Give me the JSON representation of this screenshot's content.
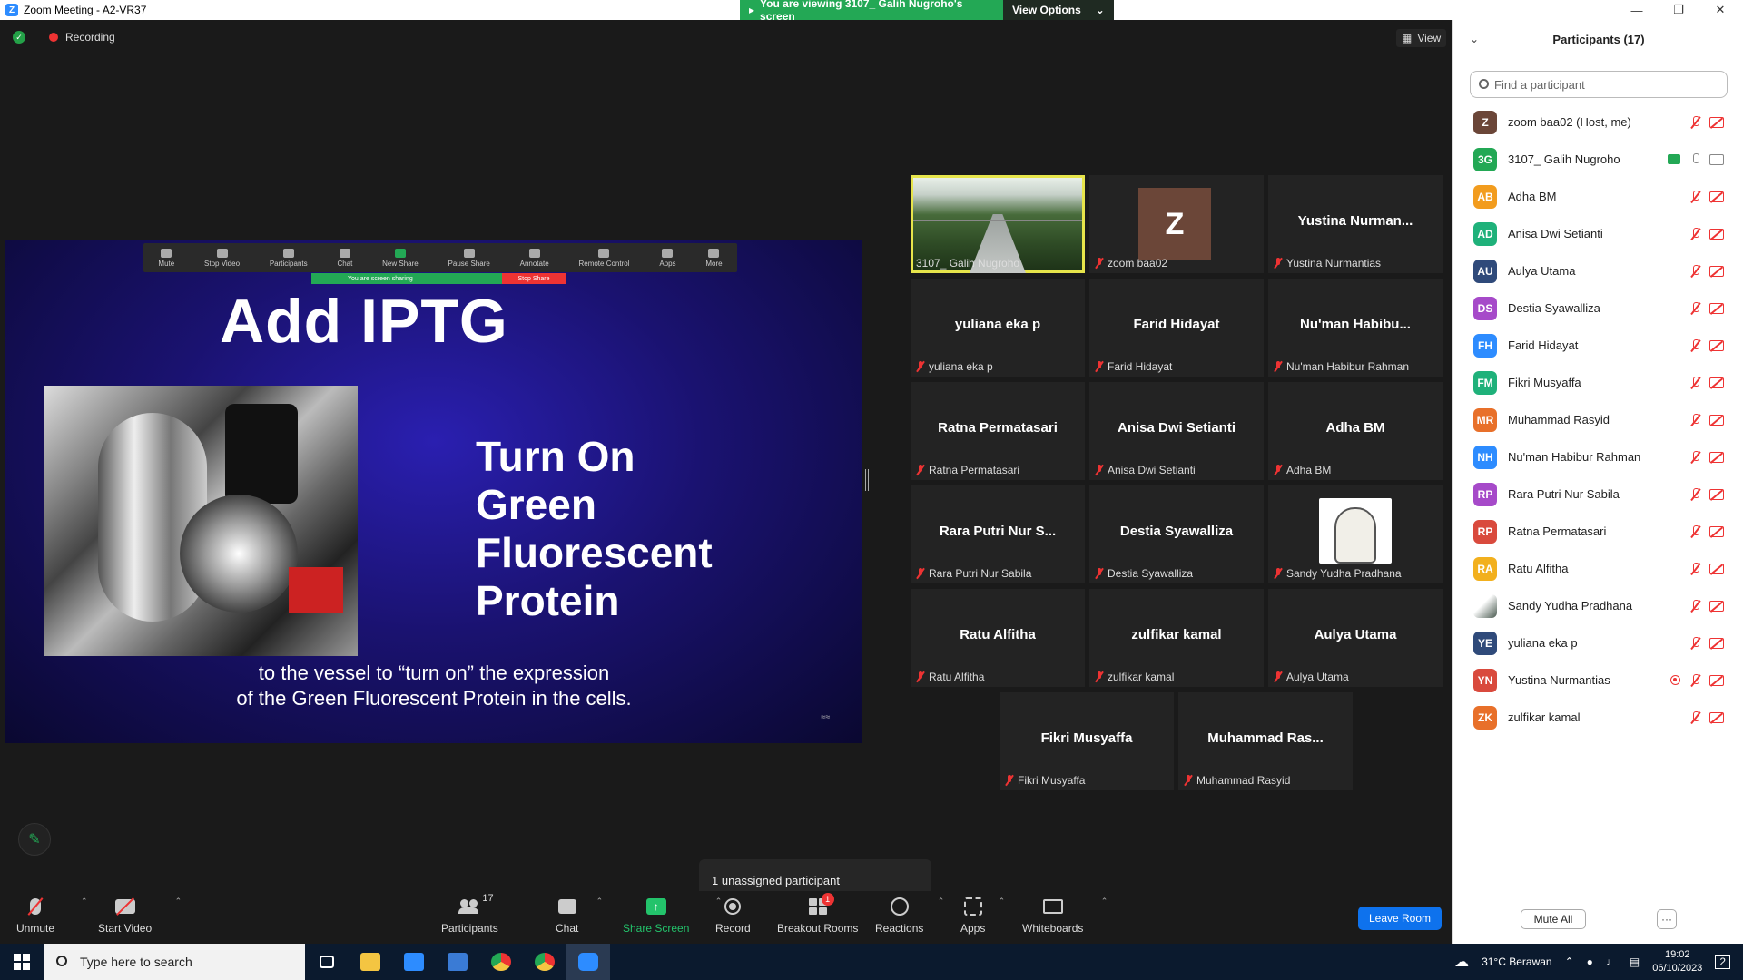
{
  "window": {
    "title": "Zoom Meeting - A2-VR37",
    "logo_letter": "Z"
  },
  "banner": {
    "viewing_text": "You are viewing 3107_ Galih Nugroho's screen",
    "view_options": "View Options"
  },
  "status": {
    "recording": "Recording",
    "view_label": "View"
  },
  "shared_screen": {
    "mini_toolbar": [
      "Mute",
      "Stop Video",
      "Participants",
      "Chat",
      "New Share",
      "Pause Share",
      "Annotate",
      "Remote Control",
      "Apps",
      "More"
    ],
    "mini_share_text": "You are screen sharing",
    "mini_stop": "Stop Share",
    "slide_title": "Add IPTG",
    "slide_lines": [
      "Turn On",
      "Green",
      "Fluorescent",
      "Protein"
    ],
    "caption_1": "to the vessel to “turn on” the expression",
    "caption_2": "of the Green Fluorescent Protein in the cells."
  },
  "grid": [
    {
      "display": "",
      "label": "3107_ Galih Nugroho",
      "muted": false,
      "kind": "video",
      "active": true
    },
    {
      "display": "Z",
      "label": "zoom baa02",
      "muted": true,
      "kind": "avatar"
    },
    {
      "display": "Yustina  Nurman...",
      "label": "Yustina Nurmantias",
      "muted": true,
      "kind": "name"
    },
    {
      "display": "yuliana eka p",
      "label": "yuliana eka p",
      "muted": true,
      "kind": "name"
    },
    {
      "display": "Farid Hidayat",
      "label": "Farid Hidayat",
      "muted": true,
      "kind": "name"
    },
    {
      "display": "Nu'man  Habibu...",
      "label": "Nu'man Habibur Rahman",
      "muted": true,
      "kind": "name"
    },
    {
      "display": "Ratna Permatasari",
      "label": "Ratna Permatasari",
      "muted": true,
      "kind": "name"
    },
    {
      "display": "Anisa Dwi Setianti",
      "label": "Anisa Dwi Setianti",
      "muted": true,
      "kind": "name"
    },
    {
      "display": "Adha BM",
      "label": "Adha BM",
      "muted": true,
      "kind": "name"
    },
    {
      "display": "Rara Putri Nur S...",
      "label": "Rara Putri Nur Sabila",
      "muted": true,
      "kind": "name"
    },
    {
      "display": "Destia Syawalliza",
      "label": "Destia Syawalliza",
      "muted": true,
      "kind": "name"
    },
    {
      "display": "",
      "label": "Sandy Yudha Pradhana",
      "muted": true,
      "kind": "bear"
    },
    {
      "display": "Ratu Alfitha",
      "label": "Ratu Alfitha",
      "muted": true,
      "kind": "name"
    },
    {
      "display": "zulfikar kamal",
      "label": "zulfikar kamal",
      "muted": true,
      "kind": "name"
    },
    {
      "display": "Aulya Utama",
      "label": "Aulya Utama",
      "muted": true,
      "kind": "name"
    },
    {
      "display": "Fikri Musyaffa",
      "label": "Fikri Musyaffa",
      "muted": true,
      "kind": "name"
    },
    {
      "display": "Muhammad  Ras...",
      "label": "Muhammad Rasyid",
      "muted": true,
      "kind": "name"
    }
  ],
  "participants_panel": {
    "title": "Participants (17)",
    "search_placeholder": "Find a participant",
    "mute_all": "Mute All",
    "more": "···",
    "list": [
      {
        "initials": "Z",
        "name": "zoom baa02 (Host, me)",
        "color": "#6b4638",
        "mic": "off",
        "cam": "off"
      },
      {
        "initials": "3G",
        "name": "3107_ Galih Nugroho",
        "color": "#23a855",
        "mic": "on",
        "cam": "on",
        "sharing": true
      },
      {
        "initials": "AB",
        "name": "Adha BM",
        "color": "#f29c1e",
        "mic": "off",
        "cam": "off"
      },
      {
        "initials": "AD",
        "name": "Anisa Dwi Setianti",
        "color": "#1fb17a",
        "mic": "off",
        "cam": "off"
      },
      {
        "initials": "AU",
        "name": "Aulya Utama",
        "color": "#2f4a7a",
        "mic": "off",
        "cam": "off"
      },
      {
        "initials": "DS",
        "name": "Destia Syawalliza",
        "color": "#a64ac9",
        "mic": "off",
        "cam": "off"
      },
      {
        "initials": "FH",
        "name": "Farid Hidayat",
        "color": "#2d8cff",
        "mic": "off",
        "cam": "off"
      },
      {
        "initials": "FM",
        "name": "Fikri Musyaffa",
        "color": "#1fb17a",
        "mic": "off",
        "cam": "off"
      },
      {
        "initials": "MR",
        "name": "Muhammad Rasyid",
        "color": "#e8702a",
        "mic": "off",
        "cam": "off"
      },
      {
        "initials": "NH",
        "name": "Nu'man Habibur Rahman",
        "color": "#2d8cff",
        "mic": "off",
        "cam": "off"
      },
      {
        "initials": "RP",
        "name": "Rara Putri Nur Sabila",
        "color": "#a64ac9",
        "mic": "off",
        "cam": "off"
      },
      {
        "initials": "RP",
        "name": "Ratna Permatasari",
        "color": "#d94a3d",
        "mic": "off",
        "cam": "off"
      },
      {
        "initials": "RA",
        "name": "Ratu Alfitha",
        "color": "#f2b01e",
        "mic": "off",
        "cam": "off"
      },
      {
        "initials": "",
        "name": "Sandy Yudha Pradhana",
        "color": "#cfd8d3",
        "mic": "off",
        "cam": "off"
      },
      {
        "initials": "YE",
        "name": "yuliana eka p",
        "color": "#2f4a7a",
        "mic": "off",
        "cam": "off"
      },
      {
        "initials": "YN",
        "name": "Yustina Nurmantias",
        "color": "#d94a3d",
        "mic": "off",
        "cam": "off",
        "recording": true
      },
      {
        "initials": "ZK",
        "name": "zulfikar kamal",
        "color": "#e8702a",
        "mic": "off",
        "cam": "off"
      }
    ]
  },
  "popover": {
    "text": "1 unassigned participant"
  },
  "toolbar": {
    "unmute": "Unmute",
    "start_video": "Start Video",
    "participants": "Participants",
    "participants_count": "17",
    "chat": "Chat",
    "share_screen": "Share Screen",
    "record": "Record",
    "breakout_rooms": "Breakout Rooms",
    "breakout_badge": "1",
    "reactions": "Reactions",
    "apps": "Apps",
    "whiteboards": "Whiteboards",
    "leave": "Leave Room"
  },
  "taskbar": {
    "search_placeholder": "Type here to search",
    "weather": "31°C  Berawan",
    "time": "19:02",
    "date": "06/10/2023",
    "notif_count": "2"
  },
  "colors": {
    "accent": "#0e72ed",
    "green": "#23a855",
    "active_border": "#e7e54b",
    "mute_red": "#e33333"
  }
}
